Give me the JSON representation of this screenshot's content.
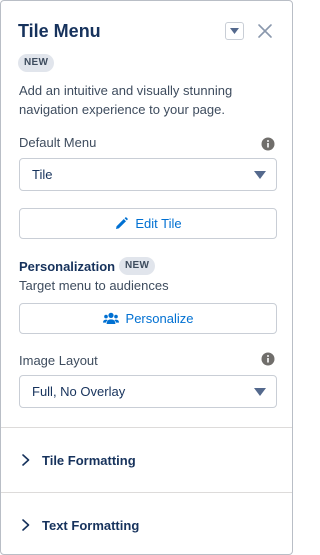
{
  "panel": {
    "title": "Tile Menu",
    "badge": "NEW",
    "description": "Add an intuitive and visually stunning navigation experience to your page."
  },
  "default_menu": {
    "label": "Default Menu",
    "value": "Tile",
    "edit_label": "Edit Tile"
  },
  "personalization": {
    "title": "Personalization",
    "badge": "NEW",
    "subtitle": "Target menu to audiences",
    "button_label": "Personalize"
  },
  "image_layout": {
    "label": "Image Layout",
    "value": "Full, No Overlay"
  },
  "sections": [
    {
      "label": "Tile Formatting"
    },
    {
      "label": "Text Formatting"
    }
  ],
  "colors": {
    "accent": "#0070d2",
    "title": "#16325c",
    "text": "#3e4c5e",
    "border": "#c9ced6"
  }
}
